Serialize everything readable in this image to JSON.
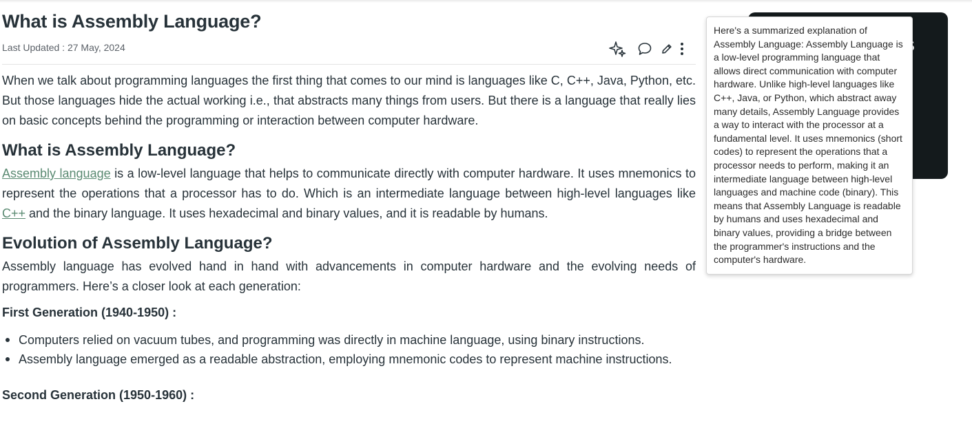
{
  "article": {
    "title": "What is Assembly Language?",
    "last_updated": "Last Updated : 27 May, 2024",
    "intro": "When we talk about programming languages the first thing that comes to our mind is languages like C, C++, Java, Python, etc. But those languages hide the actual working i.e., that abstracts many things from users. But there is a language that really lies on basic concepts behind the programming or interaction between computer hardware.",
    "section1": {
      "heading": "What is Assembly Language?",
      "link_assembly": "Assembly language",
      "text_a": " is a low-level language that helps to communicate directly with computer hardware. It uses mnemonics to represent the operations that a processor has to do. Which is an intermediate language between high-level languages like ",
      "link_cpp": "C++",
      "text_b": " and the binary language. It uses hexadecimal and binary values, and it is readable by humans."
    },
    "section2": {
      "heading": "Evolution of Assembly Language?",
      "text": "Assembly language has evolved hand in hand with advancements in computer hardware and the evolving needs of programmers. Here’s a closer look at each generation:"
    },
    "first_generation": {
      "heading": "First Generation (1940-1950) :",
      "bullets": [
        "Computers relied on vacuum tubes, and programming was directly in machine language, using binary instructions.",
        "Assembly language emerged as a readable abstraction, employing mnemonic codes to represent machine instructions."
      ]
    },
    "second_generation": {
      "heading": "Second Generation (1950-1960) :"
    }
  },
  "actions": {
    "icons": [
      "ai-sparkle-icon",
      "comment-icon",
      "edit-pencil-icon",
      "more-vertical-icon"
    ]
  },
  "promo": {
    "text_1": "s",
    "text_2": "s"
  },
  "tooltip": {
    "text": "Here's a summarized explanation of Assembly Language: Assembly Language is a low-level programming language that allows direct communication with computer hardware. Unlike high-level languages like C++, Java, or Python, which abstract away many details, Assembly Language provides a way to interact with the processor at a fundamental level. It uses mnemonics (short codes) to represent the operations that a processor needs to perform, making it an intermediate language between high-level languages and machine code (binary). This means that Assembly Language is readable by humans and uses hexadecimal and binary values, providing a bridge between the programmer's instructions and the computer's hardware."
  },
  "colors": {
    "text": "#273239",
    "link": "#5a8a72",
    "promo_bg": "#141a1c"
  }
}
